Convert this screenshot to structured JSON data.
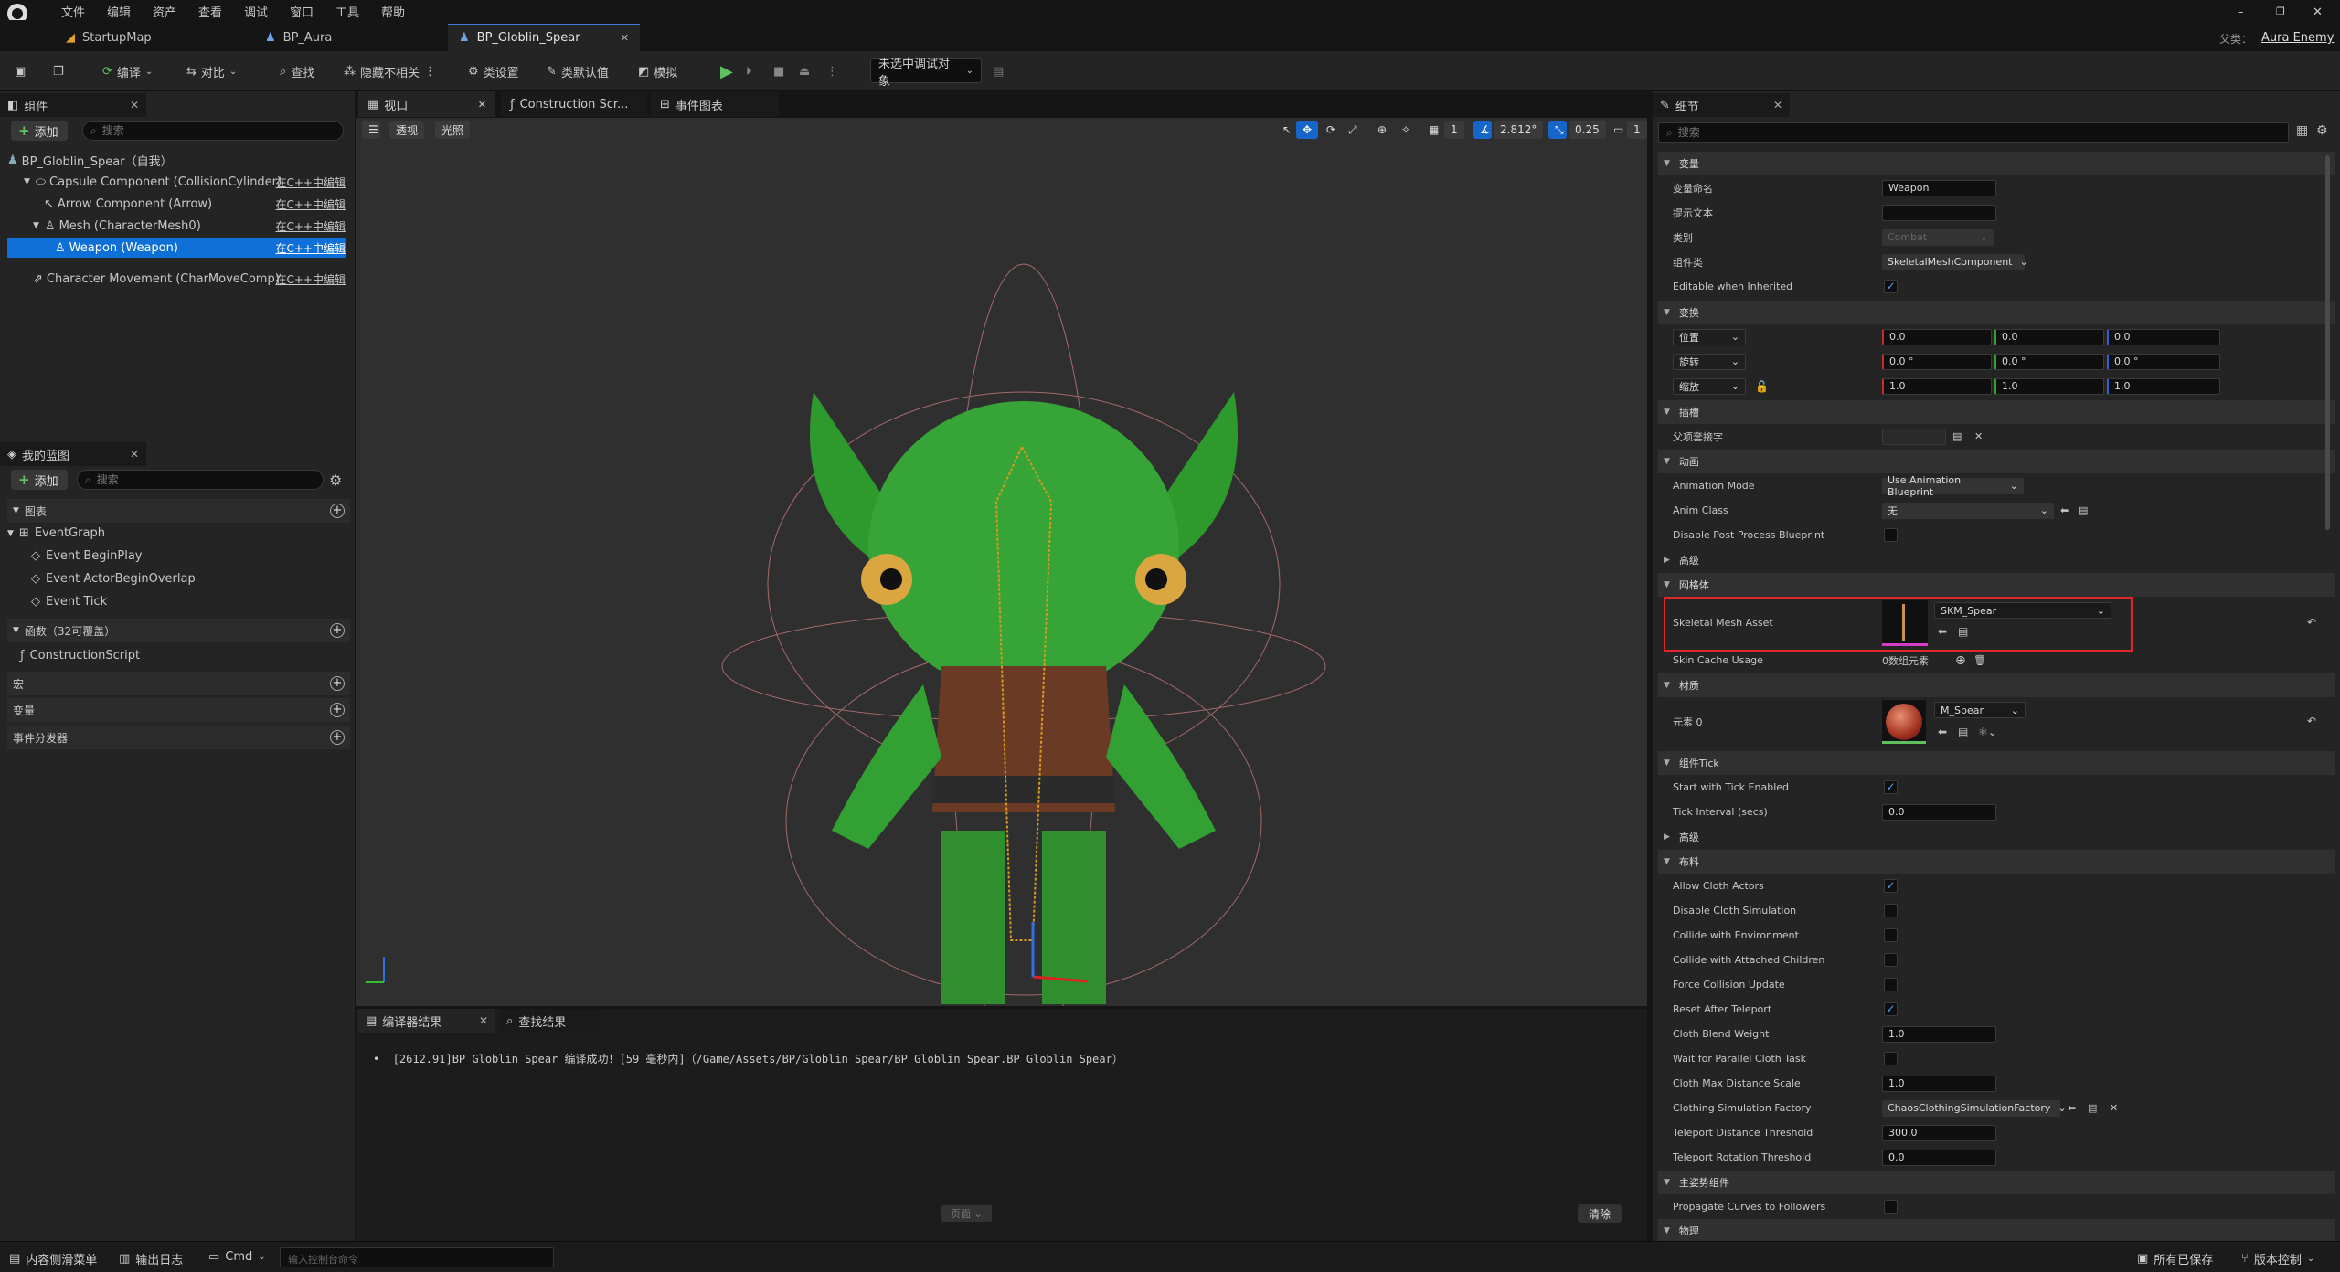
{
  "menu": [
    "文件",
    "编辑",
    "资产",
    "查看",
    "调试",
    "窗口",
    "工具",
    "帮助"
  ],
  "window_controls": {
    "min": "–",
    "max": "❐",
    "close": "✕"
  },
  "parent": {
    "label": "父类：",
    "value": "Aura Enemy"
  },
  "doc_tabs": [
    {
      "label": "StartupMap"
    },
    {
      "label": "BP_Aura"
    },
    {
      "label": "BP_Globlin_Spear"
    }
  ],
  "toolbar": {
    "compile": "编译",
    "diff": "对比",
    "find": "查找",
    "hide_unrelated": "隐藏不相关",
    "class_settings": "类设置",
    "class_defaults": "类默认值",
    "simulate": "模拟",
    "debug_target": "未选中调试对象"
  },
  "components": {
    "tab": "组件",
    "add": "添加",
    "search_placeholder": "搜索",
    "rows": [
      {
        "label": "BP_Globlin_Spear（自我）",
        "edit": ""
      },
      {
        "label": "Capsule Component (CollisionCylinder)",
        "edit": "在C++中编辑"
      },
      {
        "label": "Arrow Component (Arrow)",
        "edit": "在C++中编辑"
      },
      {
        "label": "Mesh (CharacterMesh0)",
        "edit": "在C++中编辑"
      },
      {
        "label": "Weapon (Weapon)",
        "edit": "在C++中编辑"
      },
      {
        "label": "Character Movement (CharMoveComp)",
        "edit": "在C++中编辑"
      }
    ]
  },
  "my_blueprint": {
    "tab": "我的蓝图",
    "add": "添加",
    "search_placeholder": "搜索",
    "graphs_label": "图表",
    "event_graph": "EventGraph",
    "events": [
      "Event BeginPlay",
      "Event ActorBeginOverlap",
      "Event Tick"
    ],
    "functions_label": "函数（32可覆盖）",
    "construction": "ConstructionScript",
    "macros_label": "宏",
    "variables_label": "变量",
    "dispatchers_label": "事件分发器"
  },
  "viewport": {
    "tabs": [
      "视口",
      "Construction Scr...",
      "事件图表"
    ],
    "perspective": "透视",
    "lit": "光照",
    "grid": "1",
    "angle": "2.812°",
    "scale": "0.25",
    "camera": "1"
  },
  "compile": {
    "tabs": [
      "编译器结果",
      "查找结果"
    ],
    "log": "[2612.91]BP_Globlin_Spear 编译成功！[59 毫秒内]（/Game/Assets/BP/Globlin_Spear/BP_Globlin_Spear.BP_Globlin_Spear）",
    "page": "页面",
    "clear": "清除"
  },
  "details": {
    "tab": "细节",
    "search_placeholder": "搜索",
    "sec_variable": "变量",
    "var_name_label": "变量命名",
    "var_name": "Weapon",
    "tooltip_label": "提示文本",
    "category_label": "类别",
    "category": "Combat",
    "comp_class_label": "组件类",
    "comp_class": "SkeletalMeshComponent",
    "editable_inherited": "Editable when Inherited",
    "sec_transform": "变换",
    "location": "位置",
    "rotation": "旋转",
    "scale": "缩放",
    "loc": [
      "0.0",
      "0.0",
      "0.0"
    ],
    "rot": [
      "0.0 °",
      "0.0 °",
      "0.0 °"
    ],
    "scl": [
      "1.0",
      "1.0",
      "1.0"
    ],
    "sec_socket": "插槽",
    "parent_socket": "父项套接字",
    "sec_animation": "动画",
    "anim_mode_label": "Animation Mode",
    "anim_mode": "Use Animation Blueprint",
    "anim_class_label": "Anim Class",
    "anim_class": "无",
    "disable_pp": "Disable Post Process Blueprint",
    "sec_advanced": "高级",
    "sec_mesh": "网格体",
    "skel_mesh_label": "Skeletal Mesh Asset",
    "skel_mesh": "SKM_Spear",
    "skin_cache_label": "Skin Cache Usage",
    "skin_cache": "0数组元素",
    "sec_materials": "材质",
    "element0": "元素 0",
    "material": "M_Spear",
    "sec_tick": "组件Tick",
    "start_tick": "Start with Tick Enabled",
    "tick_interval_label": "Tick Interval (secs)",
    "tick_interval": "0.0",
    "sec_advanced2": "高级",
    "sec_cloth": "布料",
    "cloth_rows": [
      {
        "label": "Allow Cloth Actors",
        "checked": true
      },
      {
        "label": "Disable Cloth Simulation",
        "checked": false
      },
      {
        "label": "Collide with Environment",
        "checked": false
      },
      {
        "label": "Collide with Attached Children",
        "checked": false
      },
      {
        "label": "Force Collision Update",
        "checked": false
      },
      {
        "label": "Reset After Teleport",
        "checked": true
      }
    ],
    "cloth_blend_label": "Cloth Blend Weight",
    "cloth_blend": "1.0",
    "wait_parallel": "Wait for Parallel Cloth Task",
    "cloth_max_label": "Cloth Max Distance Scale",
    "cloth_max": "1.0",
    "cloth_factory_label": "Clothing Simulation Factory",
    "cloth_factory": "ChaosClothingSimulationFactory",
    "teleport_dist_label": "Teleport Distance Threshold",
    "teleport_dist": "300.0",
    "teleport_rot_label": "Teleport Rotation Threshold",
    "teleport_rot": "0.0",
    "sec_leader": "主姿势组件",
    "propagate": "Propagate Curves to Followers",
    "sec_physics": "物理"
  },
  "status": {
    "drawer": "内容侧滑菜单",
    "output": "输出日志",
    "cmd": "Cmd",
    "cmd_placeholder": "输入控制台命令",
    "saved": "所有已保存",
    "source_control": "版本控制"
  },
  "colors": {
    "accent": "#0e6fd6",
    "play": "#5fc25f",
    "highlight_box": "#e0262a"
  }
}
